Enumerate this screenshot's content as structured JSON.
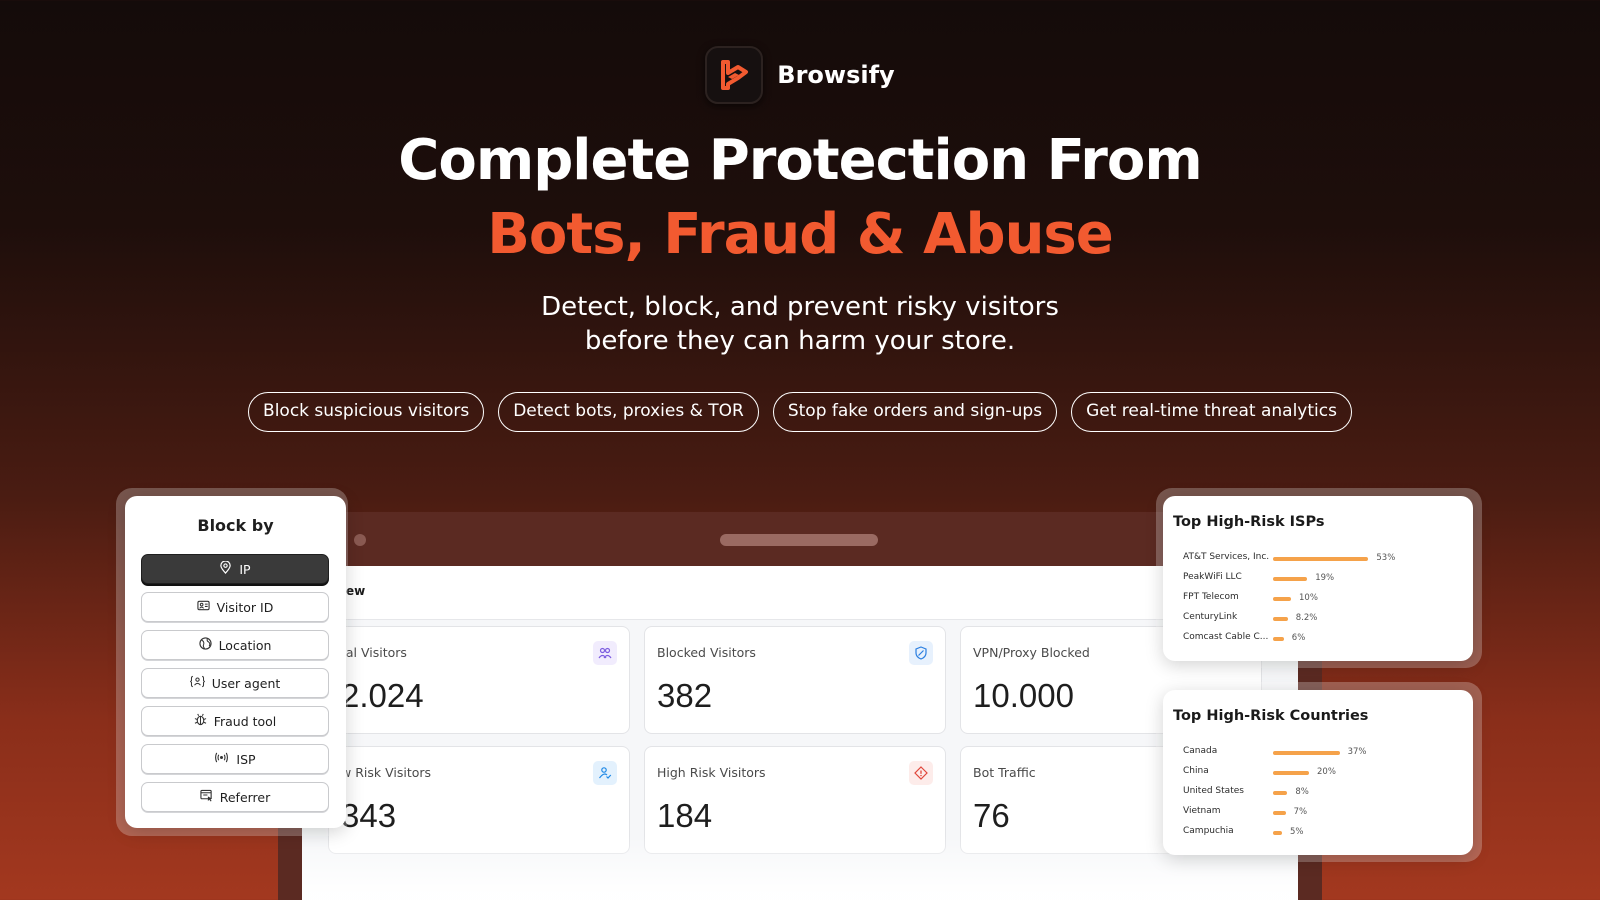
{
  "brand": {
    "name": "Browsify",
    "logo_icon": "browsify-logo-icon",
    "accent": "#f25a30"
  },
  "hero": {
    "title_line1": "Complete Protection From",
    "title_line2": "Bots, Fraud & Abuse",
    "subtitle_line1": "Detect, block, and prevent risky visitors",
    "subtitle_line2": "before they can harm your store."
  },
  "pills": [
    "Block suspicious visitors",
    "Detect bots, proxies & TOR",
    "Stop fake orders and sign-ups",
    "Get real-time threat analytics"
  ],
  "dashboard": {
    "title": "ew",
    "stats": [
      {
        "label": "tal Visitors",
        "value": "2.024",
        "icon": "users-icon",
        "icon_color": "#7c5ce0",
        "icon_bg": "#f1ecfd"
      },
      {
        "label": "Blocked Visitors",
        "value": "382",
        "icon": "shield-blocked-icon",
        "icon_color": "#2a7ee0",
        "icon_bg": "#e7f1fd"
      },
      {
        "label": "VPN/Proxy Blocked",
        "value": "10.000",
        "icon": "",
        "icon_color": "#22a86b",
        "icon_bg": "#e6f6ee"
      },
      {
        "label": "w Risk Visitors",
        "value": "343",
        "icon": "user-check-icon",
        "icon_color": "#1e88e5",
        "icon_bg": "#e3f1fd"
      },
      {
        "label": "High Risk Visitors",
        "value": "184",
        "icon": "warning-diamond-icon",
        "icon_color": "#e0463a",
        "icon_bg": "#fdecea"
      },
      {
        "label": "Bot Traffic",
        "value": "76",
        "icon": "",
        "icon_color": "#888888",
        "icon_bg": "#ffffff"
      }
    ]
  },
  "block_by": {
    "title": "Block by",
    "options": [
      {
        "label": "IP",
        "icon": "location-pin-icon",
        "active": true
      },
      {
        "label": "Visitor ID",
        "icon": "id-card-icon",
        "active": false
      },
      {
        "label": "Location",
        "icon": "globe-icon",
        "active": false
      },
      {
        "label": "User agent",
        "icon": "user-agent-icon",
        "active": false
      },
      {
        "label": "Fraud tool",
        "icon": "bug-icon",
        "active": false
      },
      {
        "label": "ISP",
        "icon": "broadcast-icon",
        "active": false
      },
      {
        "label": "Referrer",
        "icon": "referrer-icon",
        "active": false
      }
    ]
  },
  "top_isps": {
    "title": "Top High-Risk ISPs",
    "items": [
      {
        "name": "AT&T Services, Inc.",
        "pct_label": "53%",
        "value": 53
      },
      {
        "name": "PeakWiFi LLC",
        "pct_label": "19%",
        "value": 19
      },
      {
        "name": "FPT Telecom",
        "pct_label": "10%",
        "value": 10
      },
      {
        "name": "CenturyLink",
        "pct_label": "8.2%",
        "value": 8.2
      },
      {
        "name": "Comcast Cable C...",
        "pct_label": "6%",
        "value": 6
      }
    ]
  },
  "top_countries": {
    "title": "Top High-Risk Countries",
    "items": [
      {
        "name": "Canada",
        "pct_label": "37%",
        "value": 37
      },
      {
        "name": "China",
        "pct_label": "20%",
        "value": 20
      },
      {
        "name": "United States",
        "pct_label": "8%",
        "value": 8
      },
      {
        "name": "Vietnam",
        "pct_label": "7%",
        "value": 7
      },
      {
        "name": "Campuchia",
        "pct_label": "5%",
        "value": 5
      }
    ]
  }
}
